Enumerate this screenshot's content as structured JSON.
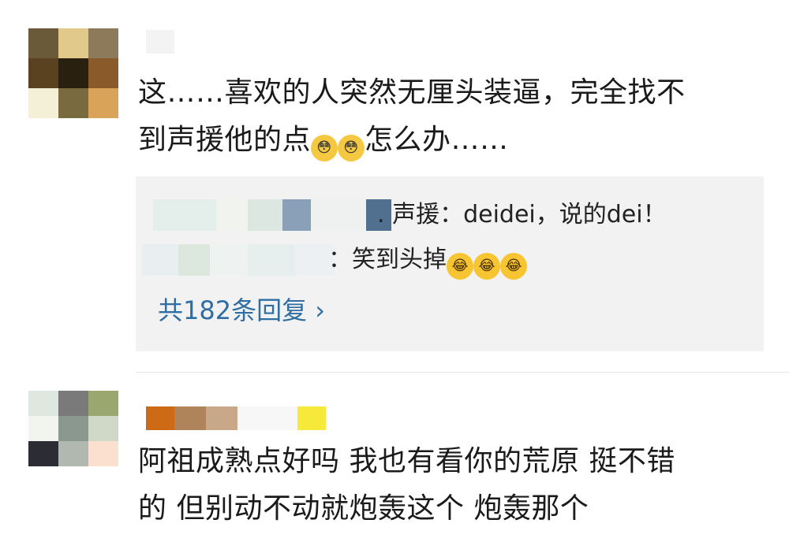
{
  "comments": [
    {
      "text_line1": "这……喜欢的人突然无厘头装逼，完全找不",
      "text_line2_a": "到声援他的点",
      "text_line2_b": "怎么办……",
      "emoji_shy": "😳",
      "replies": [
        {
          "text": ". 声援：deidei，说的dei！"
        },
        {
          "text": "：笑到头掉",
          "emoji_laugh": "😂"
        }
      ],
      "more_replies": "共182条回复 ›"
    },
    {
      "text_line1": "阿祖成熟点好吗 我也有看你的荒原 挺不错",
      "text_line2": "的 但别动不动就炮轰这个 炮轰那个"
    }
  ],
  "colors": {
    "reply_bg": "#f2f2f2",
    "link": "#2f6ea3",
    "divider": "#e6e6e6"
  }
}
